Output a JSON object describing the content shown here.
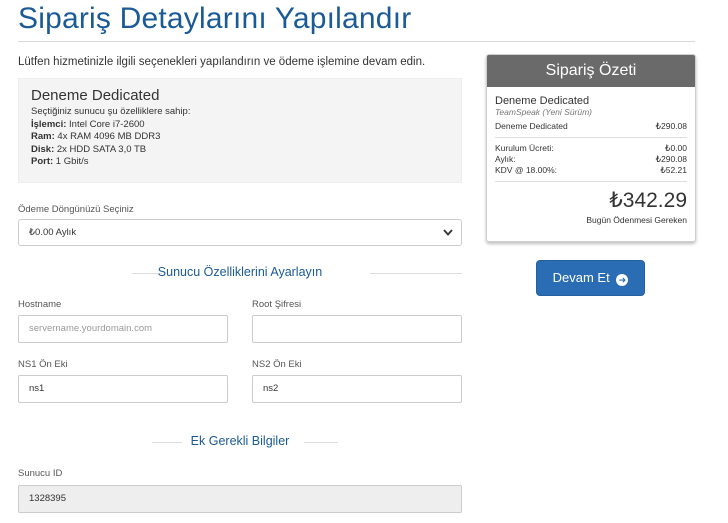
{
  "page": {
    "title": "Sipariş Detaylarını Yapılandır",
    "intro": "Lütfen hizmetinizle ilgili seçenekleri yapılandırın ve ödeme işlemine devam edin."
  },
  "product": {
    "name": "Deneme Dedicated",
    "desc_intro": "Seçtiğiniz sunucu şu özelliklere sahip:",
    "specs": [
      {
        "label": "İşlemci:",
        "value": " Intel Core i7-2600"
      },
      {
        "label": "Ram:",
        "value": " 4x RAM 4096 MB DDR3"
      },
      {
        "label": "Disk:",
        "value": " 2x HDD SATA 3,0 TB"
      },
      {
        "label": "Port:",
        "value": " 1 Gbit/s"
      }
    ]
  },
  "billing": {
    "label": "Ödeme Döngünüzü Seçiniz",
    "selected": "₺0.00 Aylık"
  },
  "server_config": {
    "heading": "Sunucu Özelliklerini Ayarlayın",
    "hostname_label": "Hostname",
    "hostname_placeholder": "servername.yourdomain.com",
    "root_label": "Root Şifresi",
    "root_value": "",
    "ns1_label": "NS1 Ön Eki",
    "ns1_value": "ns1",
    "ns2_label": "NS2 Ön Eki",
    "ns2_value": "ns2"
  },
  "additional": {
    "heading": "Ek Gerekli Bilgiler",
    "server_id_label": "Sunucu ID",
    "server_id_value": "1328395"
  },
  "summary": {
    "title": "Sipariş Özeti",
    "product": "Deneme Dedicated",
    "group": "TeamSpeak (Yeni Sürüm)",
    "line_item": {
      "label": "Deneme Dedicated",
      "amount": "₺290.08"
    },
    "rows": [
      {
        "label": "Kurulum Ücreti:",
        "amount": "₺0.00"
      },
      {
        "label": "Aylık:",
        "amount": "₺290.08"
      },
      {
        "label": "KDV @ 18.00%:",
        "amount": "₺52.21"
      }
    ],
    "total": "₺342.29",
    "total_label": "Bugün Ödenmesi Gereken"
  },
  "checkout": {
    "label": "Devam Et",
    "icon": "arrow-circle-right-icon"
  }
}
